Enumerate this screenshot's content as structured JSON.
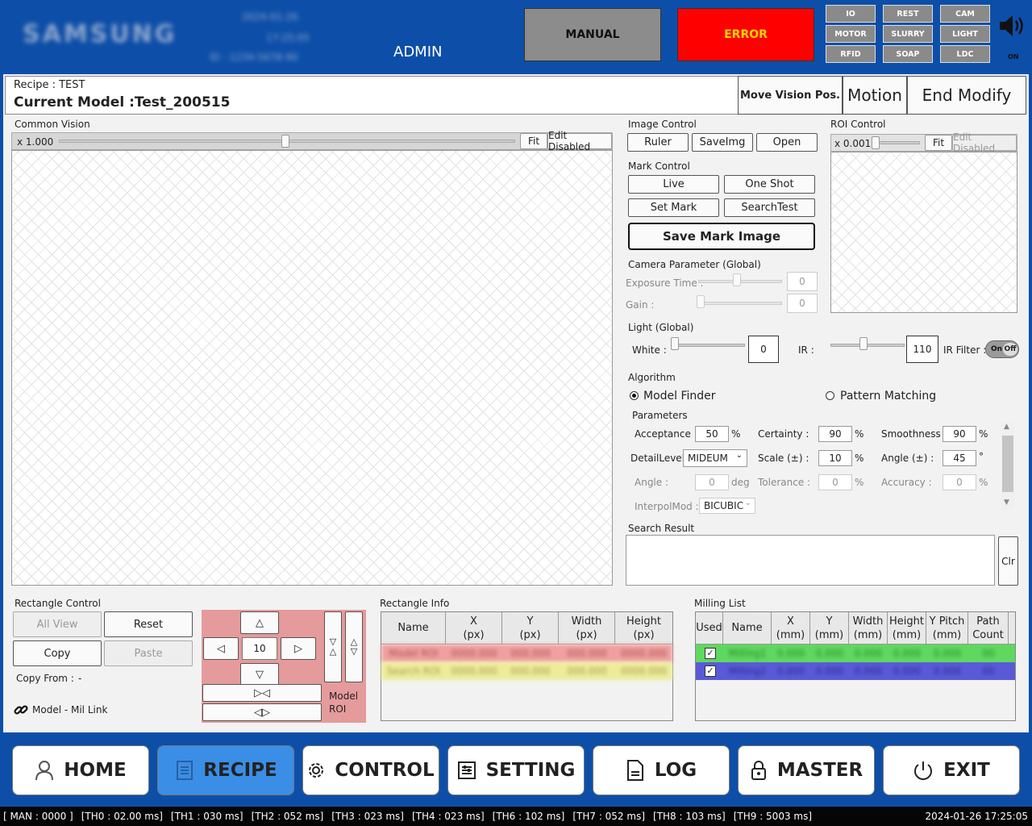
{
  "header": {
    "logo": "SAMSUNG",
    "blur_date": "2024-01-26",
    "blur_time": "17:25:05",
    "blur_ip": "ID : 1234-5678-90",
    "user": "ADMIN",
    "mode_manual": "MANUAL",
    "mode_error": "ERROR",
    "status_buttons": [
      "IO",
      "REST",
      "CAM",
      "MOTOR",
      "SLURRY",
      "LIGHT",
      "RFID",
      "SOAP",
      "LDC"
    ],
    "sound_label": "ON"
  },
  "recipe": {
    "recipe_label": "Recipe : TEST",
    "model_label": "Current Model :Test_200515",
    "move_vision": "Move Vision Pos.",
    "motion": "Motion",
    "end_modify": "End Modify"
  },
  "common_vision": {
    "title": "Common Vision",
    "zoom": "x 1.000",
    "fit": "Fit",
    "edit": "Edit Disabled"
  },
  "image_control": {
    "title": "Image Control",
    "ruler": "Ruler",
    "saveimg": "SaveImg",
    "open": "Open"
  },
  "mark_control": {
    "title": "Mark Control",
    "live": "Live",
    "one_shot": "One Shot",
    "set_mark": "Set Mark",
    "search_test": "SearchTest",
    "save_mark": "Save Mark Image"
  },
  "roi_control": {
    "title": "ROI Control",
    "zoom": "x 0.001",
    "fit": "Fit",
    "edit": "Edit Disabled"
  },
  "camera": {
    "title": "Camera Parameter (Global)",
    "exposure_label": "Exposure Time :",
    "exposure": "0",
    "gain_label": "Gain :",
    "gain": "0"
  },
  "light": {
    "title": "Light (Global)",
    "white_label": "White :",
    "white": "0",
    "ir_label": "IR :",
    "ir": "110",
    "irfilter_label": "IR Filter :",
    "on": "On",
    "off": "Off"
  },
  "algorithm": {
    "title": "Algorithm",
    "model_finder": "Model Finder",
    "pattern_matching": "Pattern Matching",
    "params_title": "Parameters",
    "acceptance_label": "Acceptance :",
    "acceptance": "50",
    "certainty_label": "Certainty :",
    "certainty": "90",
    "smoothness_label": "Smoothness :",
    "smoothness": "90",
    "detail_label": "DetailLevel :",
    "detail": "MIDEUM",
    "scale_label": "Scale (±) :",
    "scale": "10",
    "angle_pm_label": "Angle (±) :",
    "angle_pm": "45",
    "angle_label": "Angle :",
    "angle": "0",
    "deg": "deg",
    "tolerance_label": "Tolerance :",
    "tolerance": "0",
    "accuracy_label": "Accuracy :",
    "accuracy": "0",
    "interp_label": "InterpolMod :",
    "interp": "BICUBIC",
    "pct": "%",
    "degsym": "°"
  },
  "search_result": {
    "title": "Search Result",
    "clr": "Clr"
  },
  "rect_control": {
    "title": "Rectangle Control",
    "all_view": "All View",
    "reset": "Reset",
    "copy": "Copy",
    "paste": "Paste",
    "copy_from": "Copy From :",
    "copy_from_val": "-",
    "model_link": "Model - Mil Link",
    "step": "10",
    "model": "Model",
    "roi": "ROI"
  },
  "rect_info": {
    "title": "Rectangle Info",
    "headers": [
      "Name",
      "X\n(px)",
      "Y\n(px)",
      "Width\n(px)",
      "Height\n(px)"
    ],
    "rows": [
      [
        "Model ROI",
        "0000.000",
        "000.000",
        "000.000",
        "0000.000"
      ],
      [
        "Search ROI",
        "0000.000",
        "000.000",
        "000.000",
        "0000.000"
      ]
    ]
  },
  "milling": {
    "title": "Milling List",
    "headers": [
      "Used",
      "Name",
      "X\n(mm)",
      "Y\n(mm)",
      "Width\n(mm)",
      "Height\n(mm)",
      "Y Pitch\n(mm)",
      "Path\nCount"
    ],
    "rows": [
      [
        "Milling1",
        "0.000",
        "0.000",
        "0.000",
        "0.000",
        "0.000",
        "00"
      ],
      [
        "Milling2",
        "0.000",
        "0.000",
        "0.000",
        "0.000",
        "0.000",
        "00"
      ]
    ]
  },
  "nav": [
    "HOME",
    "RECIPE",
    "CONTROL",
    "SETTING",
    "LOG",
    "MASTER",
    "EXIT"
  ],
  "status_bar": [
    "[ MAN : 0000 ]",
    "[TH0 : 02.00 ms]",
    "[TH1 : 030 ms]",
    "[TH2 : 052 ms]",
    "[TH3 : 023 ms]",
    "[TH4 : 023 ms]",
    "[TH6 : 102 ms]",
    "[TH7 : 052 ms]",
    "[TH8 : 103 ms]",
    "[TH9 : 5003 ms]"
  ],
  "datetime": "2024-01-26 17:25:05"
}
